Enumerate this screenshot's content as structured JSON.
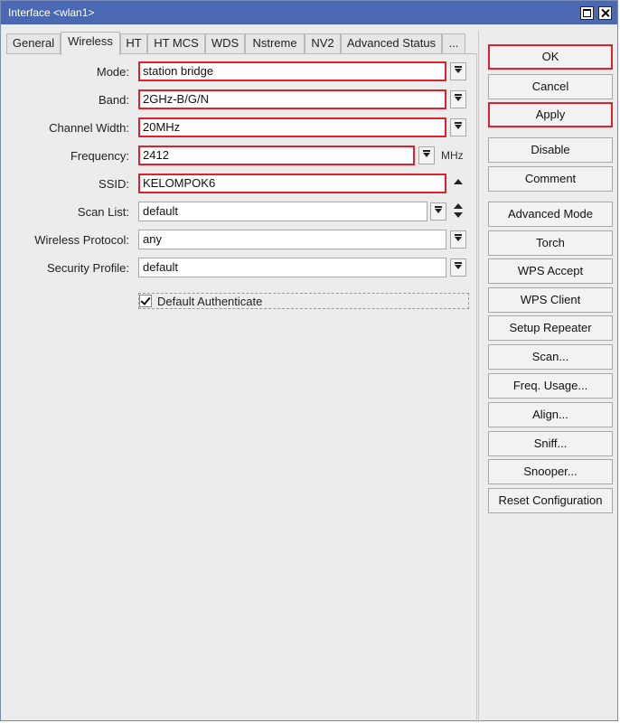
{
  "window": {
    "title": "Interface <wlan1>"
  },
  "tabs": [
    "General",
    "Wireless",
    "HT",
    "HT MCS",
    "WDS",
    "Nstreme",
    "NV2",
    "Advanced Status",
    "..."
  ],
  "active_tab": "Wireless",
  "form": {
    "mode": {
      "label": "Mode:",
      "value": "station bridge"
    },
    "band": {
      "label": "Band:",
      "value": "2GHz-B/G/N"
    },
    "channel_width": {
      "label": "Channel Width:",
      "value": "20MHz"
    },
    "frequency": {
      "label": "Frequency:",
      "value": "2412",
      "unit": "MHz"
    },
    "ssid": {
      "label": "SSID:",
      "value": "KELOMPOK6"
    },
    "scan_list": {
      "label": "Scan List:",
      "value": "default"
    },
    "wireless_protocol": {
      "label": "Wireless Protocol:",
      "value": "any"
    },
    "security_profile": {
      "label": "Security Profile:",
      "value": "default"
    },
    "default_authenticate": {
      "label": "Default Authenticate",
      "checked": true
    }
  },
  "buttons": {
    "ok": "OK",
    "cancel": "Cancel",
    "apply": "Apply",
    "disable": "Disable",
    "comment": "Comment",
    "advanced_mode": "Advanced Mode",
    "torch": "Torch",
    "wps_accept": "WPS Accept",
    "wps_client": "WPS Client",
    "setup_repeater": "Setup Repeater",
    "scan": "Scan...",
    "freq_usage": "Freq. Usage...",
    "align": "Align...",
    "sniff": "Sniff...",
    "snooper": "Snooper...",
    "reset_configuration": "Reset Configuration"
  },
  "highlight_color": "#e0202a",
  "titlebar_color": "#4b69b3"
}
